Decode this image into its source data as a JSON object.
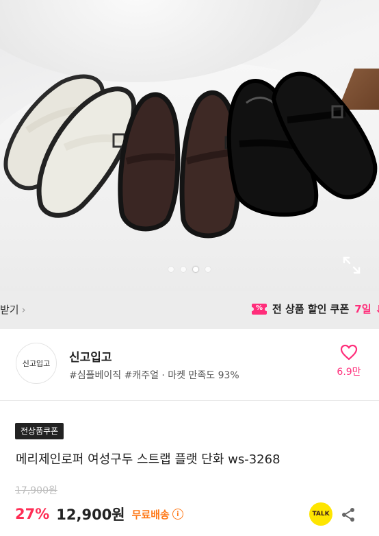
{
  "gallery": {
    "dot_count": 4,
    "active_dot_index": 2
  },
  "strip": {
    "left_text": "받기",
    "coupon_icon_glyph": "%",
    "coupon_text": "전 상품 할인 쿠폰",
    "coupon_days": "7일 ↓"
  },
  "seller": {
    "logo_text": "신고입고",
    "name": "신고입고",
    "tags": "#심플베이직 #캐주얼 · 마켓 만족도 93%",
    "likes": "6.9만"
  },
  "product": {
    "badge": "전상품쿠폰",
    "title": "메리제인로퍼 여성구두 스트랩 플랫 단화 ws-3268",
    "original_price": "17,900원",
    "discount": "27%",
    "price": "12,900원",
    "shipping": "무료배송",
    "talk_label": "TALK"
  },
  "colors": {
    "accent_pink": "#ff2d7a",
    "discount_red": "#ff2d55",
    "shipping_orange": "#ff7a1a",
    "talk_yellow": "#fee500"
  }
}
